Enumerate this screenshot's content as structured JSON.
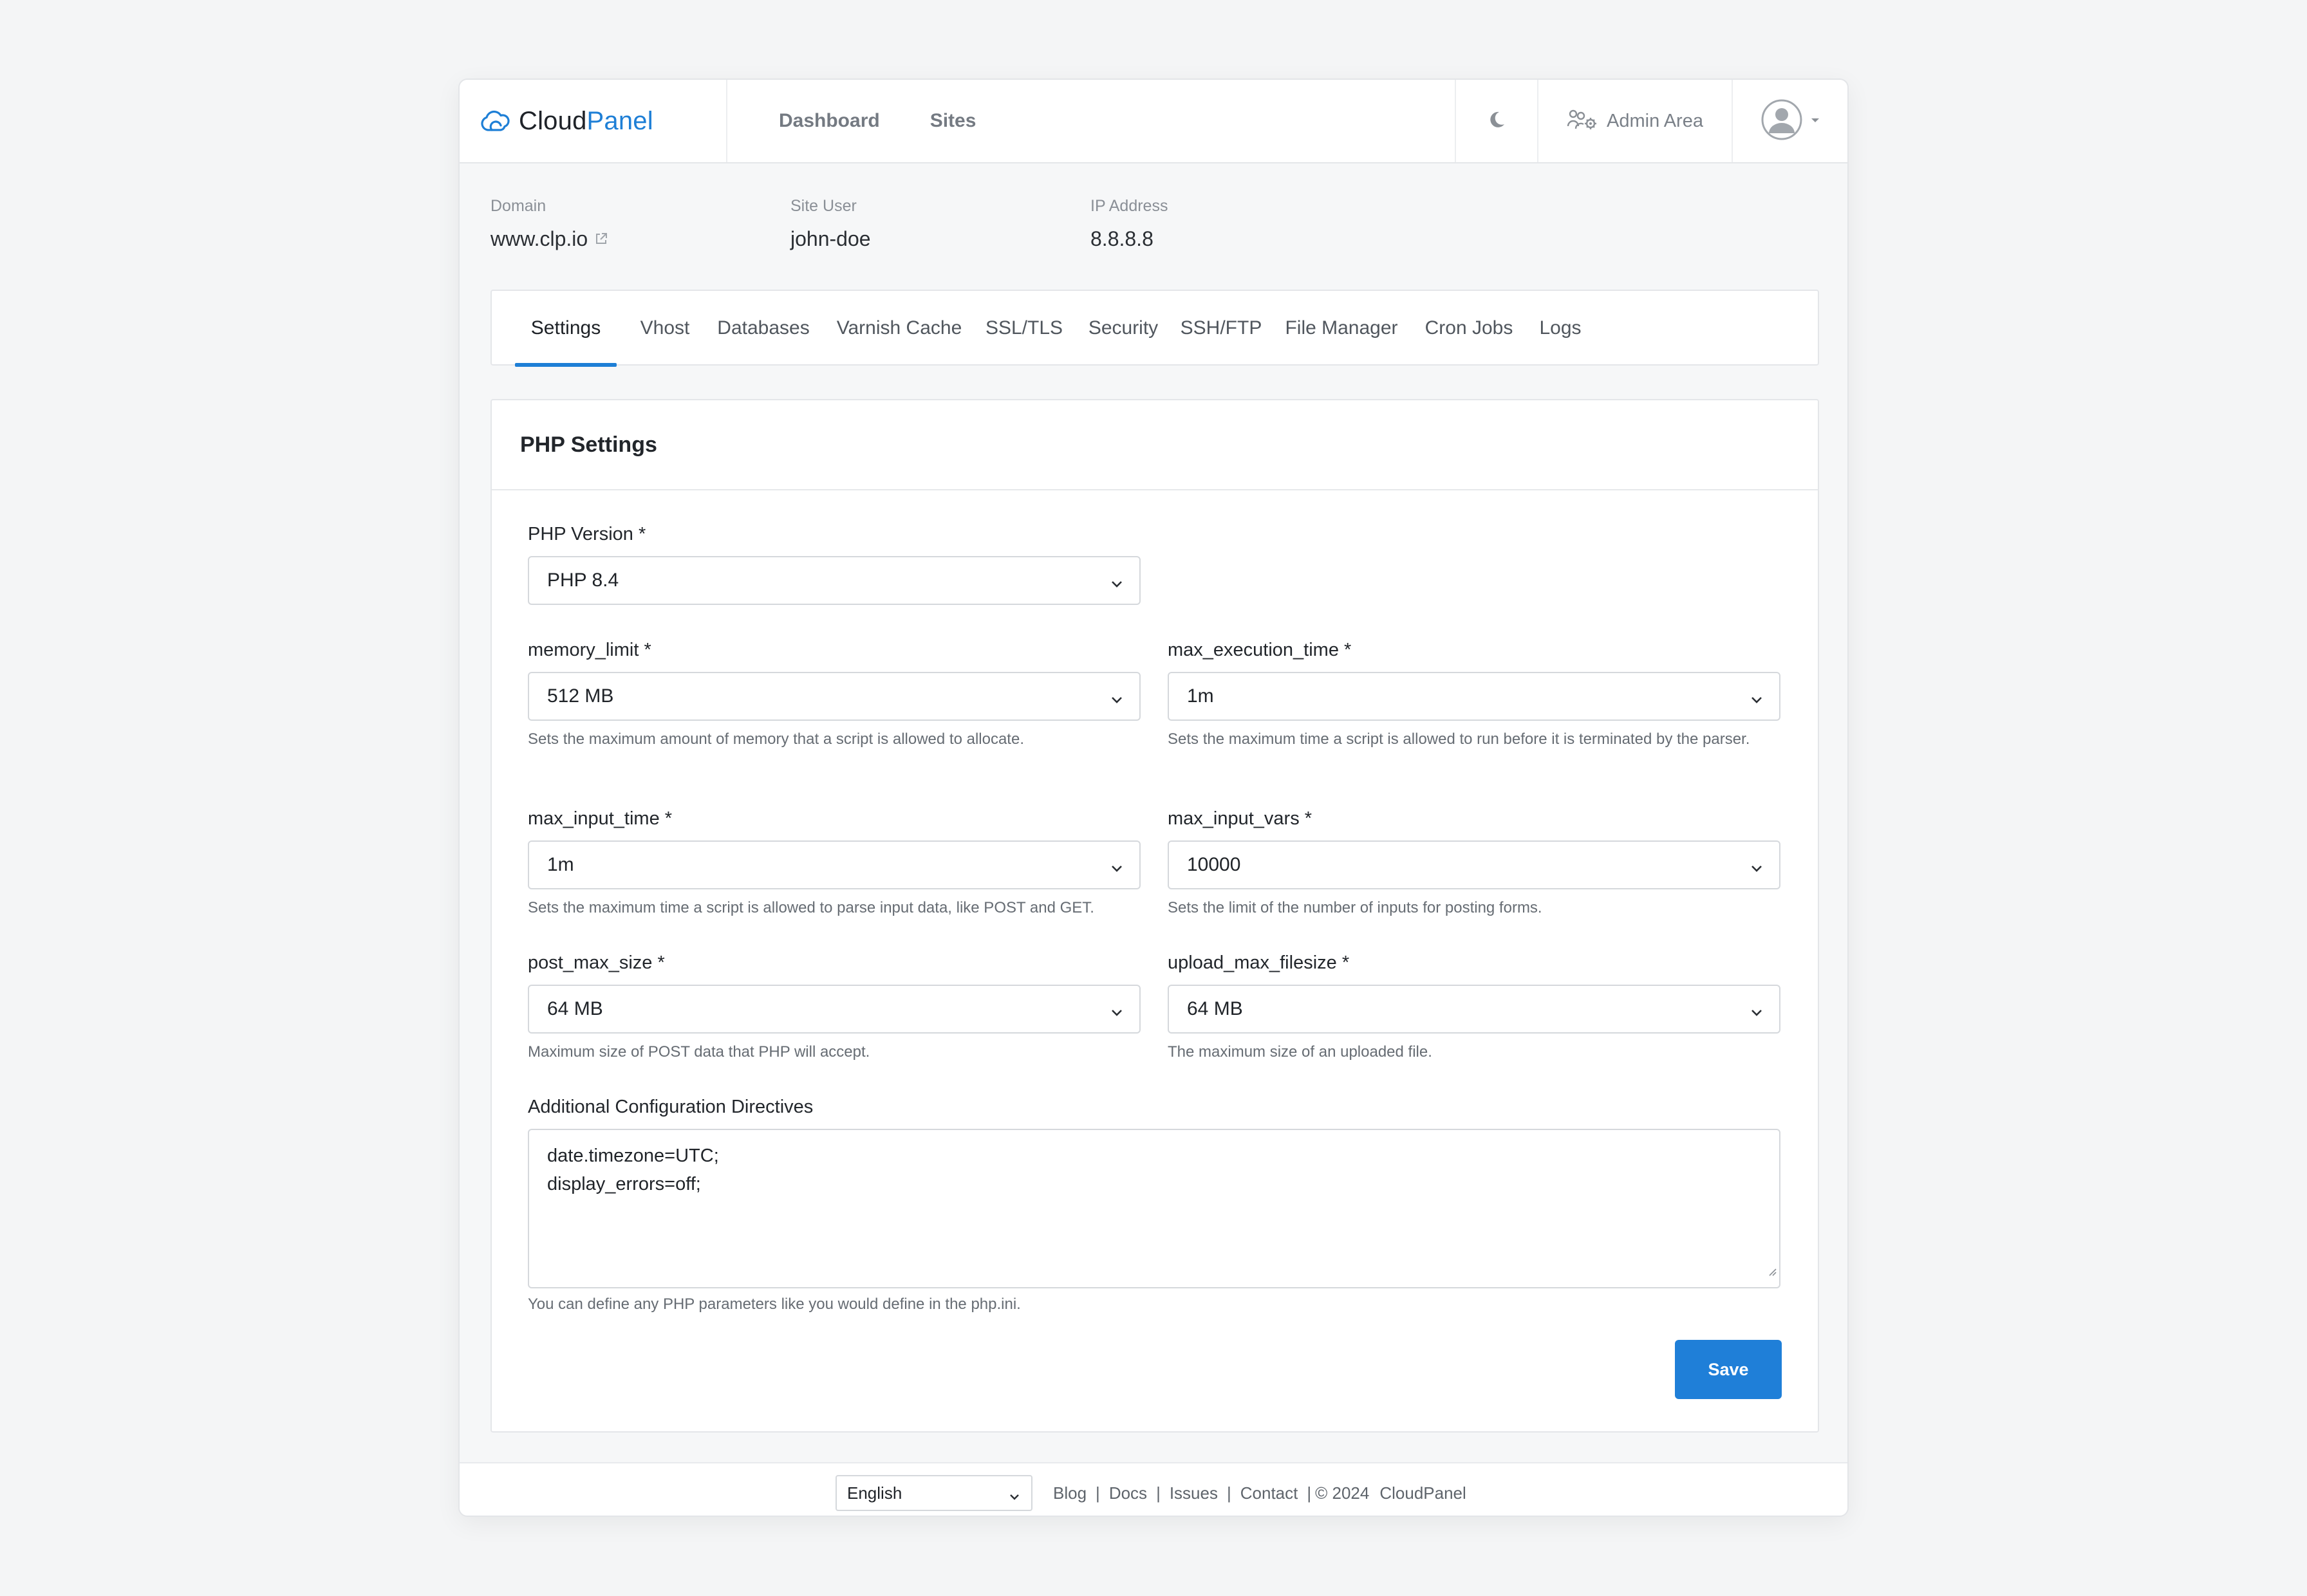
{
  "app": {
    "brand_part1": "Cloud",
    "brand_part2": "Panel",
    "accent_color": "#1e7fd6"
  },
  "header": {
    "nav": [
      "Dashboard",
      "Sites"
    ],
    "theme_icon": "moon-icon",
    "admin_label": "Admin Area",
    "admin_icon": "users-gear-icon",
    "avatar_icon": "user-avatar-icon"
  },
  "site": {
    "domain_label": "Domain",
    "domain": "www.clp.io",
    "user_label": "Site User",
    "user": "john-doe",
    "ip_label": "IP Address",
    "ip": "8.8.8.8"
  },
  "tabs": [
    "Settings",
    "Vhost",
    "Databases",
    "Varnish Cache",
    "SSL/TLS",
    "Security",
    "SSH/FTP",
    "File Manager",
    "Cron Jobs",
    "Logs"
  ],
  "active_tab": "Settings",
  "form": {
    "title": "PHP Settings",
    "php_version": {
      "label": "PHP Version *",
      "value": "PHP 8.4"
    },
    "memory_limit": {
      "label": "memory_limit *",
      "value": "512 MB",
      "help": "Sets the maximum amount of memory that a script is allowed to allocate."
    },
    "max_execution_time": {
      "label": "max_execution_time *",
      "value": "1m",
      "help": "Sets the maximum time a script is allowed to run before it is terminated by the parser."
    },
    "max_input_time": {
      "label": "max_input_time *",
      "value": "1m",
      "help": "Sets the maximum time a script is allowed to parse input data, like POST and GET."
    },
    "max_input_vars": {
      "label": "max_input_vars *",
      "value": "10000",
      "help": "Sets the limit of the number of inputs for posting forms."
    },
    "post_max_size": {
      "label": "post_max_size *",
      "value": "64 MB",
      "help": "Maximum size of POST data that PHP will accept."
    },
    "upload_max_filesize": {
      "label": "upload_max_filesize *",
      "value": "64 MB",
      "help": "The maximum size of an uploaded file."
    },
    "directives": {
      "label": "Additional Configuration Directives",
      "line1": "date.timezone=UTC;",
      "line2": "display_errors=off;",
      "help": "You can define any PHP parameters like you would define in the php.ini."
    },
    "save_label": "Save",
    "save_color": "#1f7fd8"
  },
  "footer": {
    "language": "English",
    "links": [
      "Blog",
      "Docs",
      "Issues",
      "Contact"
    ],
    "copyright": "© 2024",
    "brand": "CloudPanel"
  }
}
